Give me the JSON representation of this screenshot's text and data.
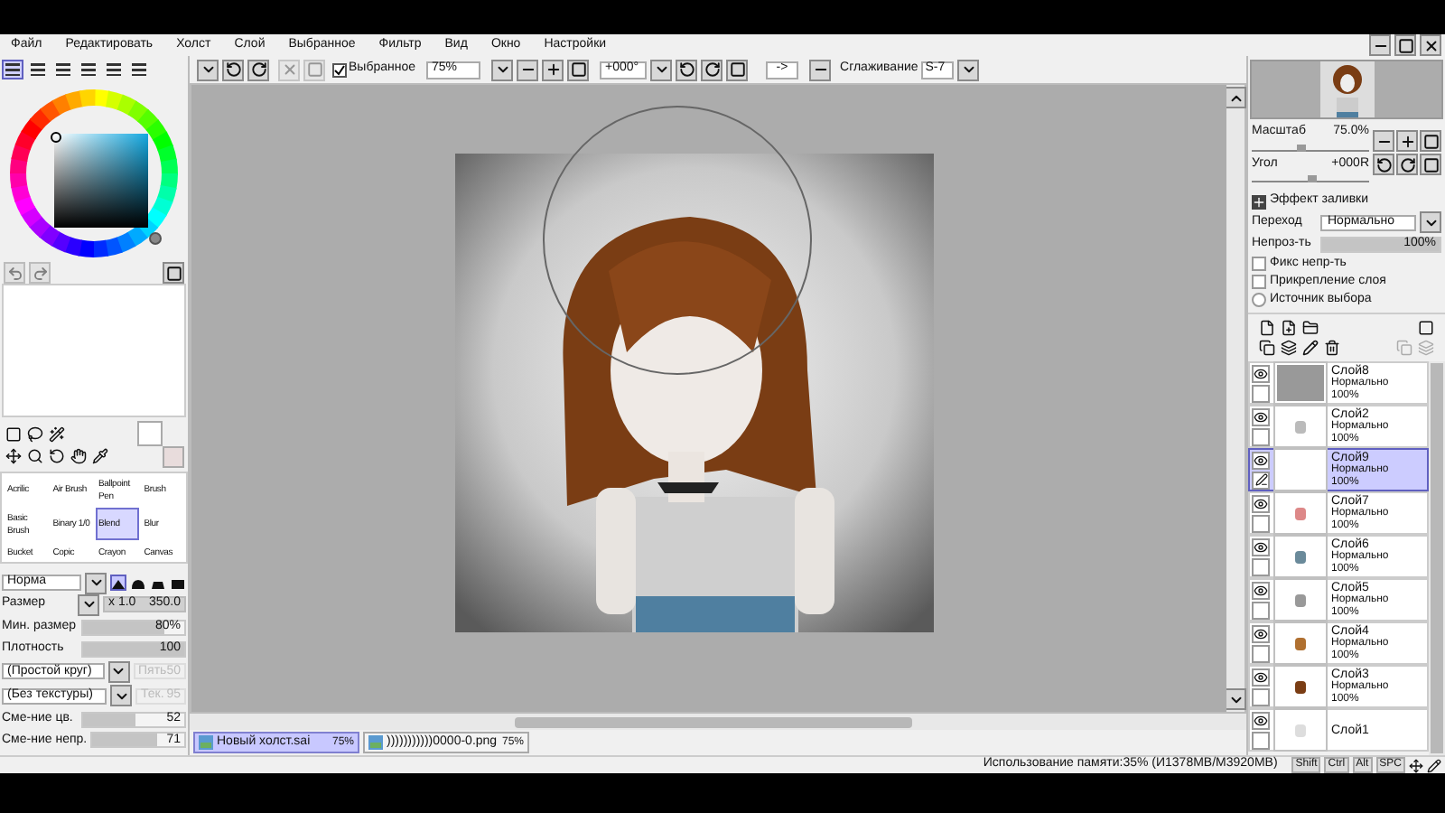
{
  "menu": [
    "Файл",
    "Редактировать",
    "Холст",
    "Слой",
    "Выбранное",
    "Фильтр",
    "Вид",
    "Окно",
    "Настройки"
  ],
  "toolbar": {
    "selection": {
      "label": "Выбранное",
      "checked": true
    },
    "zoom": "75%",
    "angle": "+000°",
    "flip": "->",
    "smoothing_label": "Сглаживание",
    "smoothing": "S-7"
  },
  "color_modes": [
    {
      "selected": true
    },
    {
      "selected": false
    },
    {
      "selected": false
    },
    {
      "selected": false
    },
    {
      "selected": false
    },
    {
      "selected": false
    }
  ],
  "brushes": [
    {
      "label": "Acrilic",
      "selected": false
    },
    {
      "label": "Air Brush",
      "selected": false
    },
    {
      "label": "Ballpoint Pen",
      "selected": false
    },
    {
      "label": "Brush",
      "selected": false
    },
    {
      "label": "Basic Brush",
      "selected": false
    },
    {
      "label": "Binary 1/0",
      "selected": false
    },
    {
      "label": "Blend",
      "selected": true
    },
    {
      "label": "Blur",
      "selected": false
    },
    {
      "label": "Bucket",
      "selected": false
    },
    {
      "label": "Copic",
      "selected": false
    },
    {
      "label": "Crayon",
      "selected": false
    },
    {
      "label": "Canvas",
      "selected": false
    }
  ],
  "brush_mode": "Норма",
  "tip_shapes": [
    {
      "selected": true
    },
    {
      "selected": false
    },
    {
      "selected": false
    },
    {
      "selected": false
    }
  ],
  "size": {
    "label": "Размер",
    "multiplier": "x 1.0",
    "value": "350.0",
    "level": 1
  },
  "sliders": [
    {
      "label": "Мин. размер",
      "value": "80%",
      "level": 0.8
    },
    {
      "label": "Плотность",
      "value": "100",
      "level": 1
    }
  ],
  "dropdowns": [
    {
      "value": "(Простой круг)",
      "strength_label": "Пять",
      "strength": "50",
      "disabled": true
    },
    {
      "value": "(Без текстуры)",
      "strength_label": "Тек.",
      "strength": "95",
      "disabled": true
    }
  ],
  "mixing": [
    {
      "label": "Сме-ние цв.",
      "value": "52",
      "level": 0.52
    },
    {
      "label": "Сме-ние непр.",
      "value": "71",
      "level": 0.71
    }
  ],
  "navigator": {
    "zoom": {
      "label": "Масштаб",
      "value": "75.0%",
      "level": 0.42
    },
    "angle": {
      "label": "Угол",
      "value": "+000R",
      "level": 0.5
    }
  },
  "layer_props": {
    "fill_effect": "Эффект заливки",
    "mode_label": "Переход",
    "mode": "Нормально",
    "opacity_label": "Непроз-ть",
    "opacity": "100%",
    "level": 1
  },
  "layer_options": [
    {
      "label": "Фикс непр-ть",
      "kind": "checkbox",
      "checked": false
    },
    {
      "label": "Прикрепление слоя",
      "kind": "checkbox",
      "checked": false
    },
    {
      "label": "Источник выбора",
      "kind": "radio",
      "checked": false
    }
  ],
  "layers": [
    {
      "name": "Слой8",
      "mode": "Нормально",
      "opacity": "100%",
      "visible": true,
      "selected": false
    },
    {
      "name": "Слой2",
      "mode": "Нормально",
      "opacity": "100%",
      "visible": true,
      "selected": false
    },
    {
      "name": "Слой9",
      "mode": "Нормально",
      "opacity": "100%",
      "visible": true,
      "selected": true
    },
    {
      "name": "Слой7",
      "mode": "Нормально",
      "opacity": "100%",
      "visible": true,
      "selected": false
    },
    {
      "name": "Слой6",
      "mode": "Нормально",
      "opacity": "100%",
      "visible": true,
      "selected": false
    },
    {
      "name": "Слой5",
      "mode": "Нормально",
      "opacity": "100%",
      "visible": true,
      "selected": false
    },
    {
      "name": "Слой4",
      "mode": "Нормально",
      "opacity": "100%",
      "visible": true,
      "selected": false
    },
    {
      "name": "Слой3",
      "mode": "Нормально",
      "opacity": "100%",
      "visible": true,
      "selected": false
    },
    {
      "name": "Слой1",
      "visible": true,
      "selected": false
    }
  ],
  "documents": [
    {
      "name": "Новый холст.sai",
      "zoom": "75%",
      "selected": true
    },
    {
      "name": ")))))))))))0000-0.png",
      "zoom": "75%",
      "selected": false
    }
  ],
  "status": {
    "memory": "Использование памяти:35% (И1378MB/M3920MB)",
    "keys": [
      "Shift",
      "Ctrl",
      "Alt",
      "SPC"
    ]
  }
}
